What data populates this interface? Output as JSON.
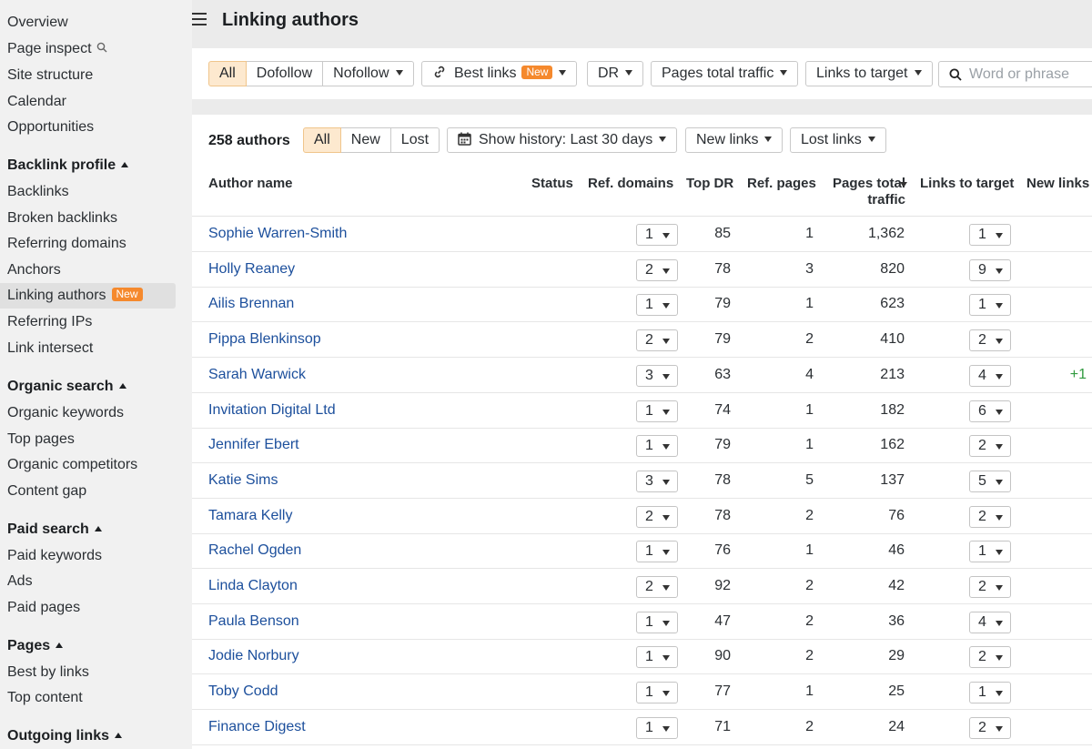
{
  "sidebar": {
    "items": [
      {
        "label": "Overview",
        "type": "item"
      },
      {
        "label": "Page inspect",
        "type": "item",
        "icon": "search-icon"
      },
      {
        "label": "Site structure",
        "type": "item"
      },
      {
        "label": "Calendar",
        "type": "item"
      },
      {
        "label": "Opportunities",
        "type": "item"
      },
      {
        "label": "Backlink profile",
        "type": "section"
      },
      {
        "label": "Backlinks",
        "type": "item"
      },
      {
        "label": "Broken backlinks",
        "type": "item"
      },
      {
        "label": "Referring domains",
        "type": "item"
      },
      {
        "label": "Anchors",
        "type": "item"
      },
      {
        "label": "Linking authors",
        "type": "item",
        "badge": "New",
        "active": true
      },
      {
        "label": "Referring IPs",
        "type": "item"
      },
      {
        "label": "Link intersect",
        "type": "item"
      },
      {
        "label": "Organic search",
        "type": "section"
      },
      {
        "label": "Organic keywords",
        "type": "item"
      },
      {
        "label": "Top pages",
        "type": "item"
      },
      {
        "label": "Organic competitors",
        "type": "item"
      },
      {
        "label": "Content gap",
        "type": "item"
      },
      {
        "label": "Paid search",
        "type": "section"
      },
      {
        "label": "Paid keywords",
        "type": "item"
      },
      {
        "label": "Ads",
        "type": "item"
      },
      {
        "label": "Paid pages",
        "type": "item"
      },
      {
        "label": "Pages",
        "type": "section"
      },
      {
        "label": "Best by links",
        "type": "item"
      },
      {
        "label": "Top content",
        "type": "item"
      },
      {
        "label": "Outgoing links",
        "type": "section"
      }
    ]
  },
  "header": {
    "title": "Linking authors"
  },
  "filters": {
    "link_type": [
      "All",
      "Dofollow",
      "Nofollow"
    ],
    "best_links": "Best links",
    "best_links_badge": "New",
    "dr": "DR",
    "pages_total_traffic": "Pages total traffic",
    "links_to_target": "Links to target",
    "search_placeholder": "Word or phrase"
  },
  "toolbar": {
    "count": "258 authors",
    "status_tabs": [
      "All",
      "New",
      "Lost"
    ],
    "history": "Show history: Last 30 days",
    "new_links": "New links",
    "lost_links": "Lost links"
  },
  "table": {
    "columns": {
      "author": "Author name",
      "status": "Status",
      "ref_domains": "Ref. domains",
      "top_dr": "Top DR",
      "ref_pages": "Ref. pages",
      "traffic_1": "Pages total",
      "traffic_2": "traffic",
      "links_to_target": "Links to target",
      "new_links": "New links"
    },
    "rows": [
      {
        "author": "Sophie Warren-Smith",
        "ref_domains": "1",
        "top_dr": "85",
        "ref_pages": "1",
        "traffic": "1,362",
        "links": "1",
        "new_links": ""
      },
      {
        "author": "Holly Reaney",
        "ref_domains": "2",
        "top_dr": "78",
        "ref_pages": "3",
        "traffic": "820",
        "links": "9",
        "new_links": ""
      },
      {
        "author": "Ailis Brennan",
        "ref_domains": "1",
        "top_dr": "79",
        "ref_pages": "1",
        "traffic": "623",
        "links": "1",
        "new_links": ""
      },
      {
        "author": "Pippa Blenkinsop",
        "ref_domains": "2",
        "top_dr": "79",
        "ref_pages": "2",
        "traffic": "410",
        "links": "2",
        "new_links": ""
      },
      {
        "author": "Sarah Warwick",
        "ref_domains": "3",
        "top_dr": "63",
        "ref_pages": "4",
        "traffic": "213",
        "links": "4",
        "new_links": "+1"
      },
      {
        "author": "Invitation Digital Ltd",
        "ref_domains": "1",
        "top_dr": "74",
        "ref_pages": "1",
        "traffic": "182",
        "links": "6",
        "new_links": ""
      },
      {
        "author": "Jennifer Ebert",
        "ref_domains": "1",
        "top_dr": "79",
        "ref_pages": "1",
        "traffic": "162",
        "links": "2",
        "new_links": ""
      },
      {
        "author": "Katie Sims",
        "ref_domains": "3",
        "top_dr": "78",
        "ref_pages": "5",
        "traffic": "137",
        "links": "5",
        "new_links": ""
      },
      {
        "author": "Tamara Kelly",
        "ref_domains": "2",
        "top_dr": "78",
        "ref_pages": "2",
        "traffic": "76",
        "links": "2",
        "new_links": ""
      },
      {
        "author": "Rachel Ogden",
        "ref_domains": "1",
        "top_dr": "76",
        "ref_pages": "1",
        "traffic": "46",
        "links": "1",
        "new_links": ""
      },
      {
        "author": "Linda Clayton",
        "ref_domains": "2",
        "top_dr": "92",
        "ref_pages": "2",
        "traffic": "42",
        "links": "2",
        "new_links": ""
      },
      {
        "author": "Paula Benson",
        "ref_domains": "1",
        "top_dr": "47",
        "ref_pages": "2",
        "traffic": "36",
        "links": "4",
        "new_links": ""
      },
      {
        "author": "Jodie Norbury",
        "ref_domains": "1",
        "top_dr": "90",
        "ref_pages": "2",
        "traffic": "29",
        "links": "2",
        "new_links": ""
      },
      {
        "author": "Toby Codd",
        "ref_domains": "1",
        "top_dr": "77",
        "ref_pages": "1",
        "traffic": "25",
        "links": "1",
        "new_links": ""
      },
      {
        "author": "Finance Digest",
        "ref_domains": "1",
        "top_dr": "71",
        "ref_pages": "2",
        "traffic": "24",
        "links": "2",
        "new_links": ""
      }
    ]
  },
  "colors": {
    "accent_orange": "#f5892d",
    "selected_segment": "#fde9cf",
    "link_blue": "#1c4f9c",
    "positive_green": "#2f9a3e"
  }
}
